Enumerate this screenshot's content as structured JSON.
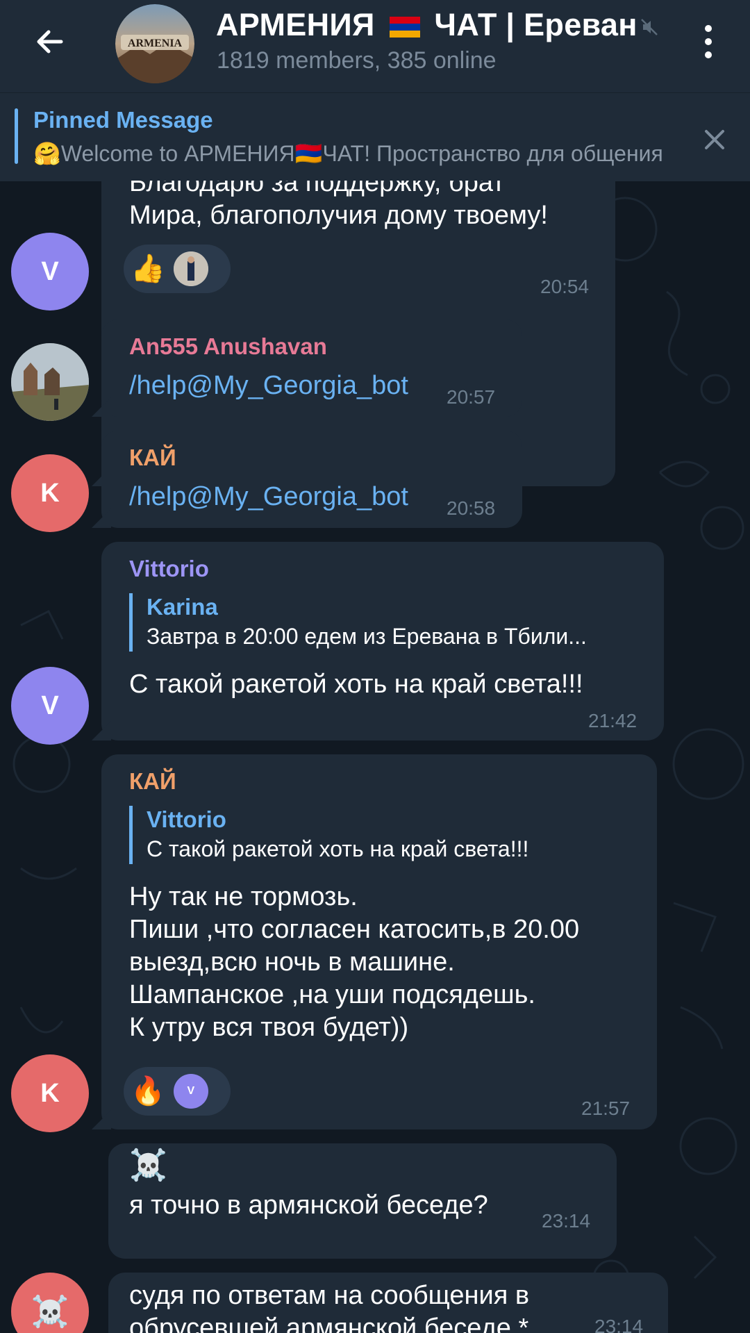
{
  "header": {
    "title": "АРМЕНИЯ",
    "title_suffix": "ЧАТ | Ереван",
    "subtitle": "1819 members, 385 online",
    "avatar_text": "ARMENIA"
  },
  "pinned": {
    "label": "Pinned Message",
    "text": "🤗Welcome to АРМЕНИЯ🇦🇲ЧАТ!  Пространство для общения"
  },
  "messages": [
    {
      "id": "m1",
      "avatar_letter": "V",
      "text": "Благодарю за поддержку, брат\nМира, благополучия дому твоему!",
      "reaction_emoji": "👍",
      "time": "20:54"
    },
    {
      "id": "m2",
      "sender": "An555 Anushavan",
      "text": "/help@My_Georgia_bot",
      "time": "20:57"
    },
    {
      "id": "m3",
      "avatar_letter": "K",
      "sender": "КАЙ",
      "text": "/help@My_Georgia_bot",
      "time": "20:58"
    },
    {
      "id": "m4",
      "avatar_letter": "V",
      "sender": "Vittorio",
      "reply_name": "Karina",
      "reply_text": "Завтра в 20:00 едем из Еревана в Тбили...",
      "text": "С такой ракетой хоть на край света!!!",
      "time": "21:42"
    },
    {
      "id": "m5",
      "avatar_letter": "K",
      "sender": "КАЙ",
      "reply_name": "Vittorio",
      "reply_text": "С такой ракетой хоть на край света!!!",
      "text": "Ну так не тормозь.\nПиши ,что согласен катосить,в 20.00\nвыезд,всю ночь в машине.\nШампанское ,на уши подсядешь.\nК утру вся твоя будет))",
      "reaction_emoji": "🔥",
      "reaction_avatar_letter": "V",
      "time": "21:57"
    },
    {
      "id": "m6",
      "emoji": "☠️",
      "text": "я точно в армянской беседе?",
      "time": "23:14"
    },
    {
      "id": "m7",
      "avatar_emoji": "☠️",
      "text": "судя по ответам на сообщения в\nобрусевшей армянской беседе  *",
      "time": "23:14"
    }
  ],
  "colors": {
    "accent": "#6ab2f2",
    "bubble": "#1f2b38",
    "avatar_purple": "#8e85ee",
    "avatar_red": "#e56a6a",
    "name_pink": "#e77a96",
    "name_orange": "#f0a06a",
    "name_violet": "#9d95f5"
  }
}
